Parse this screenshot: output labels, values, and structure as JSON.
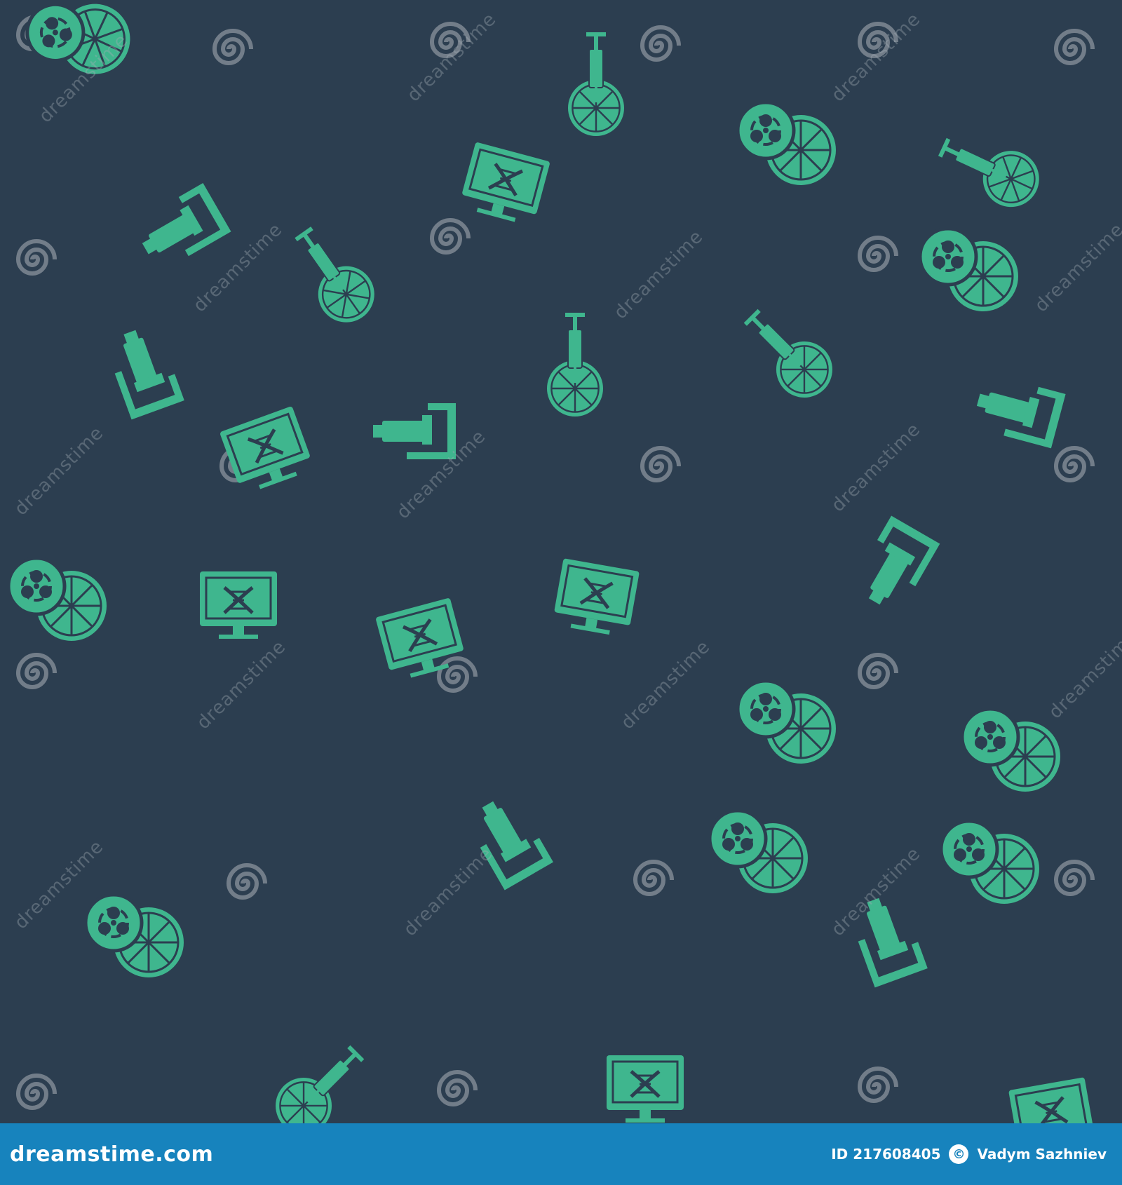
{
  "colors": {
    "background": "#2c3e50",
    "icon": "#3fb68e",
    "watermark": "#8a939c",
    "footer": "#1783bd"
  },
  "pattern": {
    "icon_types": [
      "biohazard-lemon-icon",
      "microscope-icon",
      "dna-computer-monitor-icon",
      "syringe-lemon-icon",
      "dreamstime-spiral-watermark-icon"
    ]
  },
  "watermark_text": "dreamstime",
  "footer": {
    "brand": "dreamstime.com",
    "id_label": "ID 217608405",
    "author": "Vadym Sazhniev"
  }
}
